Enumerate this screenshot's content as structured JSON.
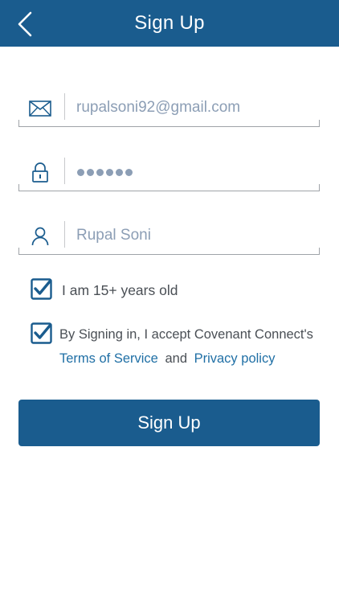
{
  "header": {
    "title": "Sign Up",
    "back_icon": "chevron-left-icon",
    "background": "#1a5c8e"
  },
  "form": {
    "email": {
      "value": "rupalsoni92@gmail.com",
      "icon": "envelope-icon"
    },
    "password": {
      "masked_length": 6,
      "icon": "lock-icon"
    },
    "name": {
      "placeholder": "Rupal Soni",
      "icon": "user-icon"
    }
  },
  "checks": {
    "age": {
      "label": "I am 15+ years old",
      "checked": true
    },
    "terms": {
      "text": "By Signing in, I accept Covenant Connect's",
      "terms_link": "Terms of Service",
      "and": "and",
      "privacy_link": "Privacy policy",
      "checked": true
    }
  },
  "submit": {
    "label": "Sign Up"
  },
  "colors": {
    "primary": "#1a5c8e",
    "link": "#1f6fa5",
    "input_text": "#8c9eb5",
    "body_text": "#4a4f55"
  }
}
